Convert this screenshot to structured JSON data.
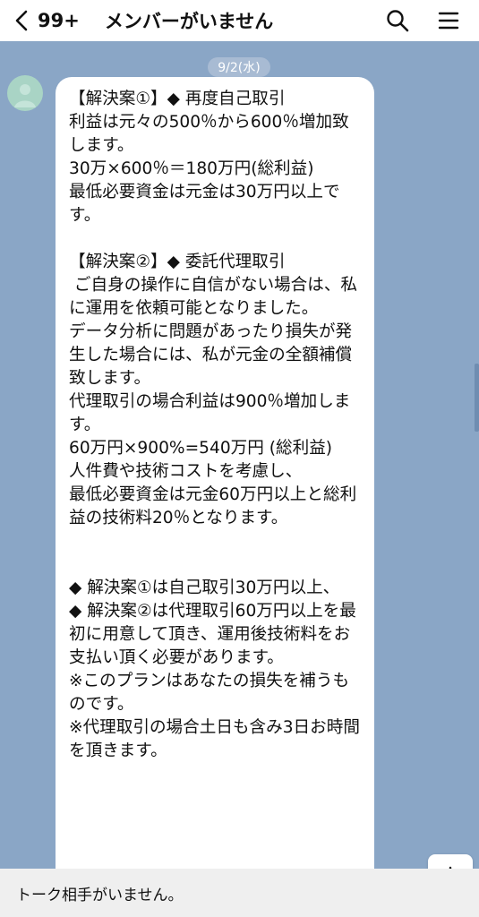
{
  "header": {
    "back_icon": "chevron-left-icon",
    "unread_badge": "99+",
    "title": "メンバーがいません",
    "search_icon": "search-icon",
    "menu_icon": "menu-icon"
  },
  "chat": {
    "date": "9/2(水)",
    "message": "【解決案①】◆ 再度自己取引\n利益は元々の500％から600％増加致します。\n30万×600％＝180万円(総利益)\n最低必要資金は元金は30万円以上です。\n\n【解決案②】◆ 委託代理取引\n ご自身の操作に自信がない場合は、私に運用を依頼可能となりました。\nデータ分析に問題があったり損失が発生した場合には、私が元金の全額補償致します。\n代理取引の場合利益は900％増加します。\n60万円×900%=540万円 (総利益)\n人件費や技術コストを考慮し、\n最低必要資金は元金60万円以上と総利益の技術料20％となります。\n\n\n◆ 解決案①は自己取引30万円以上、\n◆ 解決案②は代理取引60万円以上を最初に用意して頂き、運用後技術料をお支払い頂く必要があります。\n※このプランはあなたの損失を補うものです。\n※代理取引の場合土日も含み3日お時間を頂きます。",
    "scroll_down_icon": "arrow-down-icon"
  },
  "footer": {
    "status": "トーク相手がいません。"
  },
  "colors": {
    "chat_background": "#8aa6c6",
    "bubble": "#ffffff",
    "avatar": "#a9d4c5",
    "footer": "#efefef"
  }
}
